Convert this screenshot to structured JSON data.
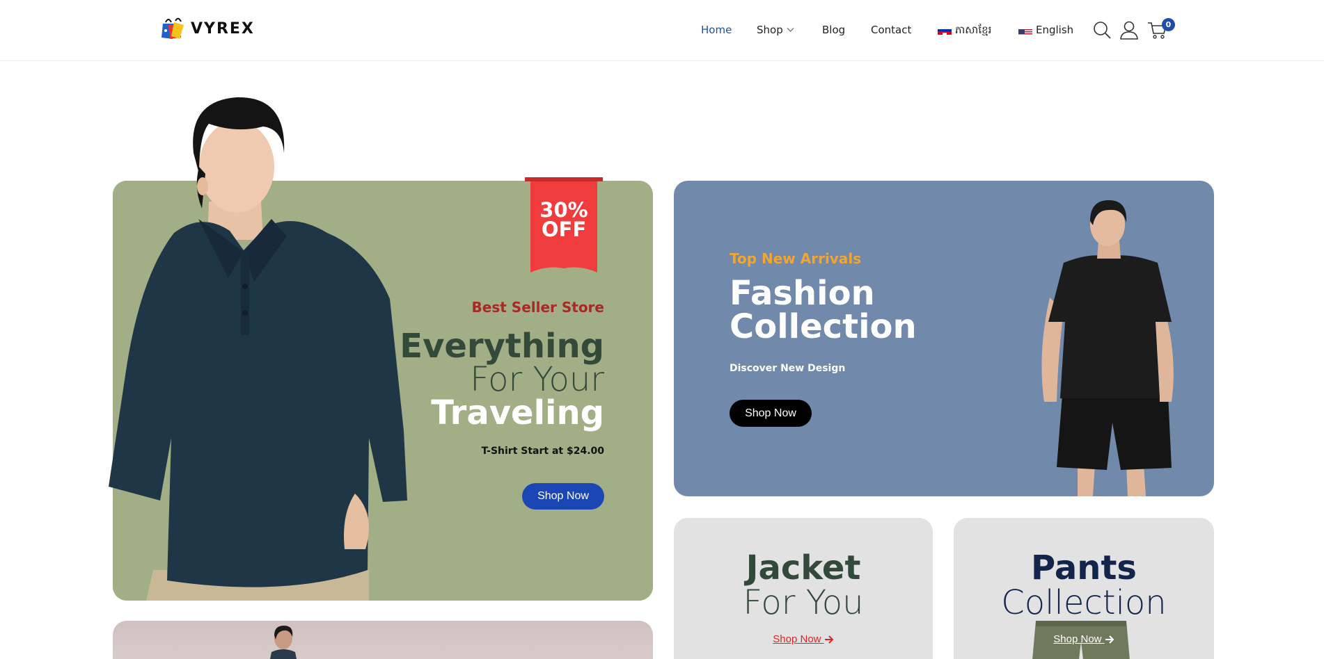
{
  "header": {
    "logo_text": "VYREX",
    "nav": [
      {
        "label": "Home",
        "active": true
      },
      {
        "label": "Shop",
        "has_dropdown": true
      },
      {
        "label": "Blog"
      },
      {
        "label": "Contact"
      },
      {
        "label": "ភាសាខ្មែរ",
        "flag": "cambodia-flag-icon"
      },
      {
        "label": "English",
        "flag": "us-flag-icon"
      }
    ],
    "icons": [
      "search-icon",
      "user-icon",
      "cart-icon"
    ],
    "cart_count": "0"
  },
  "hero_left": {
    "badge_line1": "30%",
    "badge_line2": "OFF",
    "subtitle": "Best Seller Store",
    "title_line1": "Everything",
    "title_line2": "For Your",
    "title_line3": "Traveling",
    "price_text": "T-Shirt Start at $24.00",
    "button_label": "Shop Now"
  },
  "hero_right": {
    "subtitle": "Top New Arrivals",
    "title_line1": "Fashion",
    "title_line2": "Collection",
    "description": "Discover New Design",
    "button_label": "Shop Now"
  },
  "card_jacket": {
    "title_line1": "Jacket",
    "title_line2": "For You",
    "link_label": "Shop Now"
  },
  "card_pants": {
    "title_line1": "Pants",
    "title_line2": "Collection",
    "link_label": "Shop Now"
  },
  "colors": {
    "accent_blue": "#1b47b4",
    "left_card": "#a1ae86",
    "right_card": "#7189aa",
    "badge_red": "#f03c3c",
    "best_seller_red": "#a52a28",
    "arrivals_orange": "#f0a631",
    "small_card_bg": "#e2e2e2"
  }
}
